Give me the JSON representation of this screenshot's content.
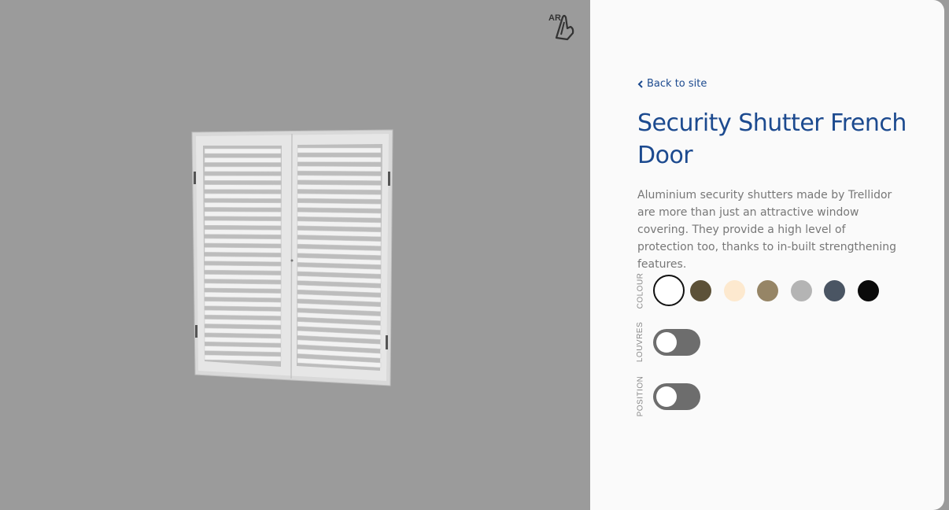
{
  "viewer": {
    "ar_label": "AR"
  },
  "panel": {
    "back_label": "Back to site",
    "title": "Security Shutter French Door",
    "description": "Aluminium security shutters made by Trellidor are more than just an attractive window covering. They provide a high level of protection too, thanks to in-built strengthening features.",
    "colour_label": "COLOUR",
    "colours": [
      {
        "name": "white",
        "hex": "#ffffff",
        "selected": true
      },
      {
        "name": "bronze",
        "hex": "#5c5138",
        "selected": false
      },
      {
        "name": "ivory",
        "hex": "#fde9cf",
        "selected": false
      },
      {
        "name": "khaki",
        "hex": "#968566",
        "selected": false
      },
      {
        "name": "silver",
        "hex": "#b4b4b4",
        "selected": false
      },
      {
        "name": "charcoal",
        "hex": "#4a5563",
        "selected": false
      },
      {
        "name": "black",
        "hex": "#0a0a0a",
        "selected": false
      }
    ],
    "louvres_label": "LOUVRES",
    "louvres_on": false,
    "position_label": "POSITION",
    "position_on": false
  },
  "colors": {
    "accent": "#1c4a8f",
    "viewer_bg": "#9b9b9b",
    "toggle_off": "#6d6d6d"
  }
}
